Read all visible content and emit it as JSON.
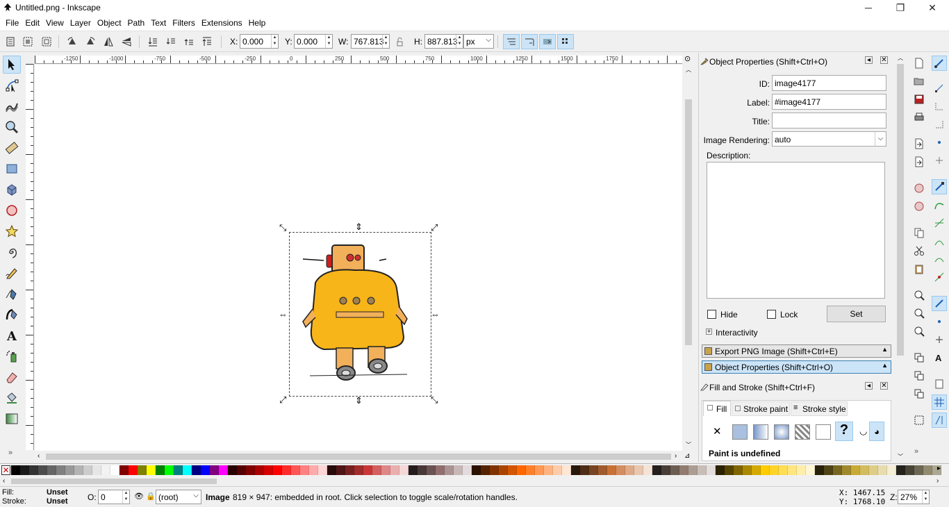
{
  "window": {
    "title": "Untitled.png - Inkscape",
    "minimize": "─",
    "maximize": "❐",
    "close": "✕"
  },
  "menu": [
    "File",
    "Edit",
    "View",
    "Layer",
    "Object",
    "Path",
    "Text",
    "Filters",
    "Extensions",
    "Help"
  ],
  "toolbar": {
    "x_label": "X:",
    "x_value": "0.000",
    "y_label": "Y:",
    "y_value": "0.000",
    "w_label": "W:",
    "w_value": "767.813",
    "h_label": "H:",
    "h_value": "887.813",
    "unit": "px"
  },
  "rulers": {
    "h_ticks": [
      "-1250",
      "-1000",
      "-750",
      "-500",
      "-250",
      "0",
      "250",
      "500",
      "750",
      "1000",
      "1250",
      "1500",
      "1750"
    ],
    "v_ticks": [
      "0",
      "1000",
      "1500",
      "1000",
      "500",
      "0"
    ]
  },
  "object_properties": {
    "header": "Object Properties (Shift+Ctrl+O)",
    "id_label": "ID:",
    "id_value": "image4177",
    "label_label": "Label:",
    "label_value": "#image4177",
    "title_label": "Title:",
    "title_value": "",
    "rendering_label": "Image Rendering:",
    "rendering_value": "auto",
    "description_label": "Description:",
    "hide_label": "Hide",
    "lock_label": "Lock",
    "set_label": "Set",
    "interactivity_label": "Interactivity"
  },
  "collapsed_panels": [
    "Export PNG Image (Shift+Ctrl+E)",
    "Object Properties (Shift+Ctrl+O)"
  ],
  "fill_stroke": {
    "header": "Fill and Stroke (Shift+Ctrl+F)",
    "tabs": [
      "Fill",
      "Stroke paint",
      "Stroke style"
    ],
    "status": "Paint is undefined"
  },
  "palette": [
    "#000000",
    "#1a1a1a",
    "#333333",
    "#4d4d4d",
    "#666666",
    "#808080",
    "#999999",
    "#b3b3b3",
    "#cccccc",
    "#e6e6e6",
    "#f2f2f2",
    "#ffffff",
    "#800000",
    "#ff0000",
    "#808000",
    "#ffff00",
    "#008000",
    "#00ff00",
    "#008080",
    "#00ffff",
    "#000080",
    "#0000ff",
    "#800080",
    "#ff00ff",
    "#2b0000",
    "#550000",
    "#800000",
    "#aa0000",
    "#d40000",
    "#ff0000",
    "#ff2a2a",
    "#ff5555",
    "#ff8080",
    "#ffaaaa",
    "#ffd5d5",
    "#280b0b",
    "#501616",
    "#782121",
    "#a02c2c",
    "#c83737",
    "#d35f5f",
    "#de8787",
    "#e9afaf",
    "#f4d7d7",
    "#241c1c",
    "#483737",
    "#6c5353",
    "#916f6f",
    "#ac9393",
    "#c8b7b7",
    "#e3dbdb",
    "#2b1100",
    "#552200",
    "#803300",
    "#aa4400",
    "#d45500",
    "#ff6600",
    "#ff7f2a",
    "#ff9955",
    "#ffb380",
    "#ffccaa",
    "#ffe6d5",
    "#28170b",
    "#502d16",
    "#784421",
    "#a05a2c",
    "#c87137",
    "#d38d5f",
    "#deaa87",
    "#e9c6af",
    "#f4e3d7",
    "#241f1c",
    "#483e37",
    "#6c5d53",
    "#917c6f",
    "#ac9d93",
    "#c8beb7",
    "#e3dedb",
    "#2b2200",
    "#554400",
    "#806600",
    "#aa8800",
    "#d4aa00",
    "#ffcc00",
    "#ffd42a",
    "#ffdd55",
    "#ffe680",
    "#ffeeaa",
    "#fff6d5",
    "#28220b",
    "#504416",
    "#786721",
    "#a0892c",
    "#c8ab37",
    "#d3bc5f",
    "#decd87",
    "#e9ddaf",
    "#f4eed7",
    "#24221c",
    "#484537",
    "#6c6753",
    "#918a6f",
    "#aca793",
    "#c8c4b7",
    "#e3e2db",
    "#222b00",
    "#445500",
    "#668000",
    "#88aa00",
    "#aad400",
    "#ccff00"
  ],
  "status": {
    "fill_label": "Fill:",
    "fill_value": "Unset",
    "stroke_label": "Stroke:",
    "stroke_value": "Unset",
    "opacity_label": "O:",
    "opacity_value": "0",
    "layer": "(root)",
    "message_bold": "Image",
    "message": " 819 × 947: embedded in root. Click selection to toggle scale/rotation handles.",
    "x_coord": "X: 1467.15",
    "y_coord": "Y: 1768.10",
    "zoom_label": "Z:",
    "zoom_value": "27%"
  }
}
